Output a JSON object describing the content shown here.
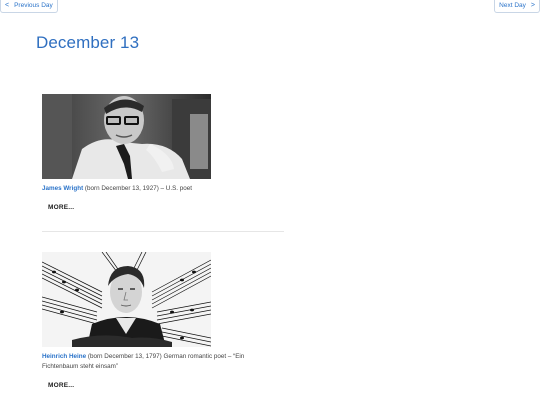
{
  "nav": {
    "prev_label": "Previous Day",
    "next_label": "Next Day",
    "prev_icon": "chevron-left-icon",
    "next_icon": "chevron-right-icon"
  },
  "page": {
    "title": "December 13"
  },
  "entries": [
    {
      "name": "James Wright",
      "desc": " (born December 13, 1927) – U.S. poet",
      "more": "MORE..."
    },
    {
      "name": "Heinrich Heine",
      "desc": " (born December 13, 1797) German romantic poet – “Ein Fichtenbaum steht einsam”",
      "more": "MORE..."
    }
  ],
  "colors": {
    "accent": "#2f6fc0",
    "link": "#2a73c9"
  }
}
